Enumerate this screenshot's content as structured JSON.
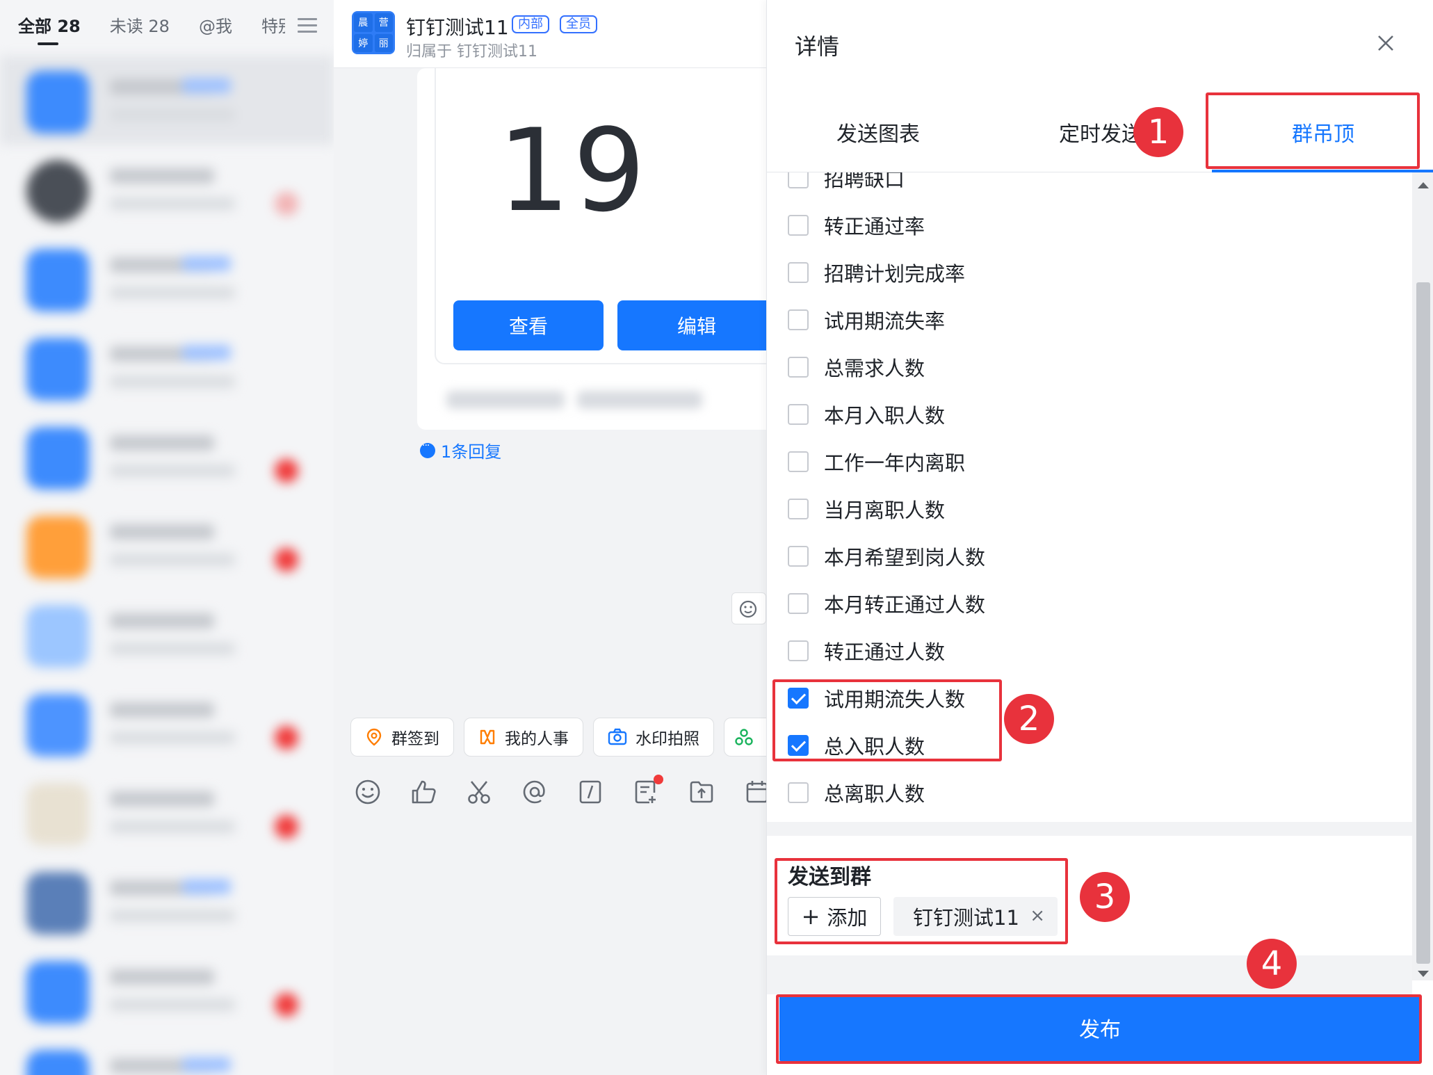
{
  "left_panel": {
    "tabs": [
      "全部 28",
      "未读 28",
      "@我",
      "特别"
    ]
  },
  "chat": {
    "group_avatar_chars": [
      "晨",
      "营",
      "婷",
      "丽"
    ],
    "title": "钉钉测试11",
    "tags": [
      "内部",
      "全员"
    ],
    "subtitle": "归属于 钉钉测试11",
    "card": {
      "value": "19",
      "view_button": "查看",
      "edit_button": "编辑"
    },
    "reply_link": "1条回复",
    "quick_apps": [
      "群签到",
      "我的人事",
      "水印拍照"
    ]
  },
  "panel": {
    "title": "详情",
    "tabs": [
      "发送图表",
      "定时发送",
      "群吊顶"
    ],
    "active_tab": "群吊顶",
    "metrics": [
      {
        "label": "招聘缺口",
        "checked": false
      },
      {
        "label": "转正通过率",
        "checked": false
      },
      {
        "label": "招聘计划完成率",
        "checked": false
      },
      {
        "label": "试用期流失率",
        "checked": false
      },
      {
        "label": "总需求人数",
        "checked": false
      },
      {
        "label": "本月入职人数",
        "checked": false
      },
      {
        "label": "工作一年内离职",
        "checked": false
      },
      {
        "label": "当月离职人数",
        "checked": false
      },
      {
        "label": "本月希望到岗人数",
        "checked": false
      },
      {
        "label": "本月转正通过人数",
        "checked": false
      },
      {
        "label": "转正通过人数",
        "checked": false
      },
      {
        "label": "试用期流失人数",
        "checked": true
      },
      {
        "label": "总入职人数",
        "checked": true
      },
      {
        "label": "总离职人数",
        "checked": false
      }
    ],
    "send_to_group_label": "发送到群",
    "add_button": "添加",
    "selected_group": "钉钉测试11",
    "remove_symbol": "×",
    "publish_button": "发布"
  },
  "annotations": [
    "1",
    "2",
    "3",
    "4"
  ],
  "colors": {
    "accent": "#1677ff",
    "annotation_red": "#e8323c"
  }
}
